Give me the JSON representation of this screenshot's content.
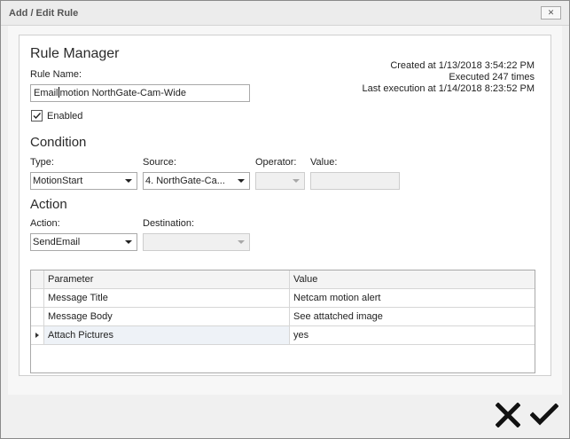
{
  "window": {
    "title": "Add / Edit Rule",
    "close_glyph": "✕"
  },
  "rule_manager": {
    "heading": "Rule Manager",
    "rule_name_label": "Rule Name:",
    "rule_name_before_caret": "Email",
    "rule_name_after_caret": "motion NorthGate-Cam-Wide",
    "enabled_label": "Enabled",
    "enabled_checked": true,
    "created": "Created at 1/13/2018 3:54:22 PM",
    "executed": "Executed 247 times",
    "last_execution": "Last execution at 1/14/2018 8:23:52 PM"
  },
  "condition": {
    "heading": "Condition",
    "type_label": "Type:",
    "type_value": "MotionStart",
    "source_label": "Source:",
    "source_value": "4. NorthGate-Ca...",
    "operator_label": "Operator:",
    "operator_value": "",
    "value_label": "Value:",
    "value_value": ""
  },
  "action": {
    "heading": "Action",
    "action_label": "Action:",
    "action_value": "SendEmail",
    "destination_label": "Destination:",
    "destination_value": ""
  },
  "parameters_grid": {
    "columns": [
      "Parameter",
      "Value"
    ],
    "rows": [
      {
        "parameter": "Message Title",
        "value": "Netcam motion alert"
      },
      {
        "parameter": "Message Body",
        "value": "See attatched image"
      },
      {
        "parameter": "Attach Pictures",
        "value": "yes"
      }
    ],
    "current_row_index": 2
  },
  "footer": {
    "cancel_icon": "x-icon",
    "confirm_icon": "checkmark-icon"
  },
  "colors": {
    "title_text": "#555555",
    "panel_border": "#cfcfcf",
    "icon_color": "#111111"
  }
}
